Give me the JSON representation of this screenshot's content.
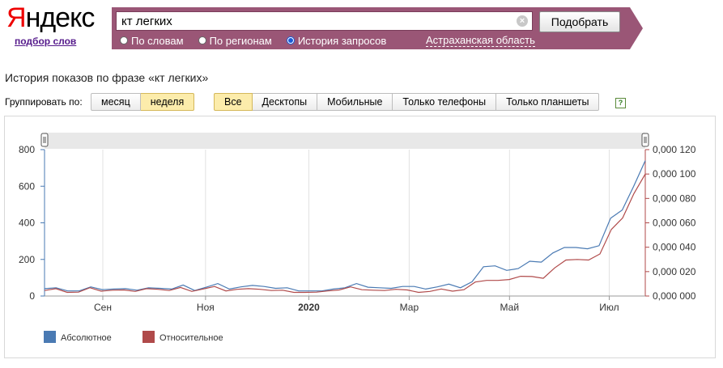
{
  "logo": {
    "first_letter": "Я",
    "rest": "ндекс",
    "sub_link": "подбор слов"
  },
  "search": {
    "query": "кт легких",
    "clear": "×",
    "submit_label": "Подобрать"
  },
  "modes": [
    {
      "label": "По словам",
      "selected": false
    },
    {
      "label": "По регионам",
      "selected": false
    },
    {
      "label": "История запросов",
      "selected": true
    }
  ],
  "region": "Астраханская область",
  "page_title": "История показов по фразе «кт легких»",
  "grouping": {
    "label": "Группировать по:",
    "options": [
      {
        "label": "месяц",
        "active": false
      },
      {
        "label": "неделя",
        "active": true
      }
    ]
  },
  "devices": [
    {
      "label": "Все",
      "active": true
    },
    {
      "label": "Десктопы",
      "active": false
    },
    {
      "label": "Мобильные",
      "active": false
    },
    {
      "label": "Только телефоны",
      "active": false
    },
    {
      "label": "Только планшеты",
      "active": false
    }
  ],
  "help": "?",
  "colors": {
    "absolute": "#4a7ab3",
    "relative": "#b04a4a",
    "band": "#9a5676"
  },
  "chart_data": {
    "type": "line",
    "x_ticks": [
      "Сен",
      "Ноя",
      "2020",
      "Мар",
      "Май",
      "Июл"
    ],
    "x_ticks_bold": [
      false,
      false,
      true,
      false,
      false,
      false
    ],
    "y_left_ticks": [
      "0",
      "200",
      "400",
      "600",
      "800"
    ],
    "y_left_range": [
      0,
      800
    ],
    "y_right_ticks": [
      "0,000 000",
      "0,000 020",
      "0,000 040",
      "0,000 060",
      "0,000 080",
      "0,000 100",
      "0,000 120"
    ],
    "y_right_range": [
      0,
      0.00012
    ],
    "grid": "vertical",
    "legend_position": "bottom-left",
    "series": [
      {
        "name": "Абсолютное",
        "axis": "left",
        "values": [
          40,
          45,
          28,
          28,
          50,
          35,
          38,
          40,
          32,
          45,
          42,
          38,
          60,
          30,
          48,
          68,
          38,
          50,
          58,
          52,
          42,
          45,
          28,
          28,
          28,
          38,
          45,
          68,
          48,
          45,
          42,
          52,
          52,
          38,
          50,
          65,
          45,
          78,
          160,
          165,
          140,
          150,
          190,
          185,
          235,
          265,
          265,
          258,
          275,
          425,
          470,
          600,
          740
        ]
      },
      {
        "name": "Относительное",
        "axis": "right",
        "values": [
          4.5e-06,
          6e-06,
          3e-06,
          3.2e-06,
          6.8e-06,
          4e-06,
          4.8e-06,
          5e-06,
          3.8e-06,
          6e-06,
          5.5e-06,
          4.5e-06,
          7e-06,
          3.8e-06,
          5.8e-06,
          7.8e-06,
          4.2e-06,
          5.5e-06,
          6e-06,
          5.5e-06,
          4.5e-06,
          4.8e-06,
          3e-06,
          3e-06,
          3.2e-06,
          4.2e-06,
          5e-06,
          7.5e-06,
          5.2e-06,
          4.8e-06,
          4.5e-06,
          5.5e-06,
          5e-06,
          3e-06,
          3.8e-06,
          5.8e-06,
          4e-06,
          5.2e-06,
          1.15e-05,
          1.28e-05,
          1.28e-05,
          1.35e-05,
          1.62e-05,
          1.6e-05,
          1.45e-05,
          2.3e-05,
          2.95e-05,
          3e-05,
          2.95e-05,
          3.45e-05,
          5.45e-05,
          6.4e-05,
          8.4e-05,
          0.0001
        ]
      }
    ]
  }
}
